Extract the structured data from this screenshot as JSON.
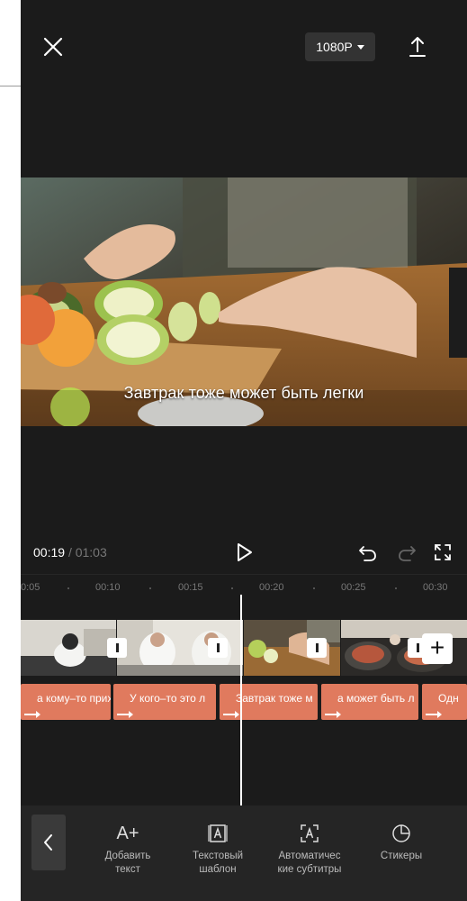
{
  "top_bar": {
    "resolution": "1080P"
  },
  "preview": {
    "subtitle": "Завтрак тоже может быть легки"
  },
  "playback": {
    "current_time": "00:19",
    "separator": "/",
    "total_time": "01:03"
  },
  "timeline": {
    "ruler_labels": [
      "0:05",
      "00:10",
      "00:15",
      "00:20",
      "00:25",
      "00:30"
    ],
    "text_clips": [
      "а кому–то прих",
      "У кого–то это л",
      "Завтрак тоже м",
      "а может быть л",
      "Одн"
    ]
  },
  "toolbar": {
    "add_text_line1": "Добавить",
    "add_text_line2": "текст",
    "text_template_line1": "Текстовый",
    "text_template_line2": "шаблон",
    "auto_subtitles_line1": "Автоматичес",
    "auto_subtitles_line2": "кие субтитры",
    "stickers_label": "Стикеры",
    "add_text_icon": "A+"
  }
}
